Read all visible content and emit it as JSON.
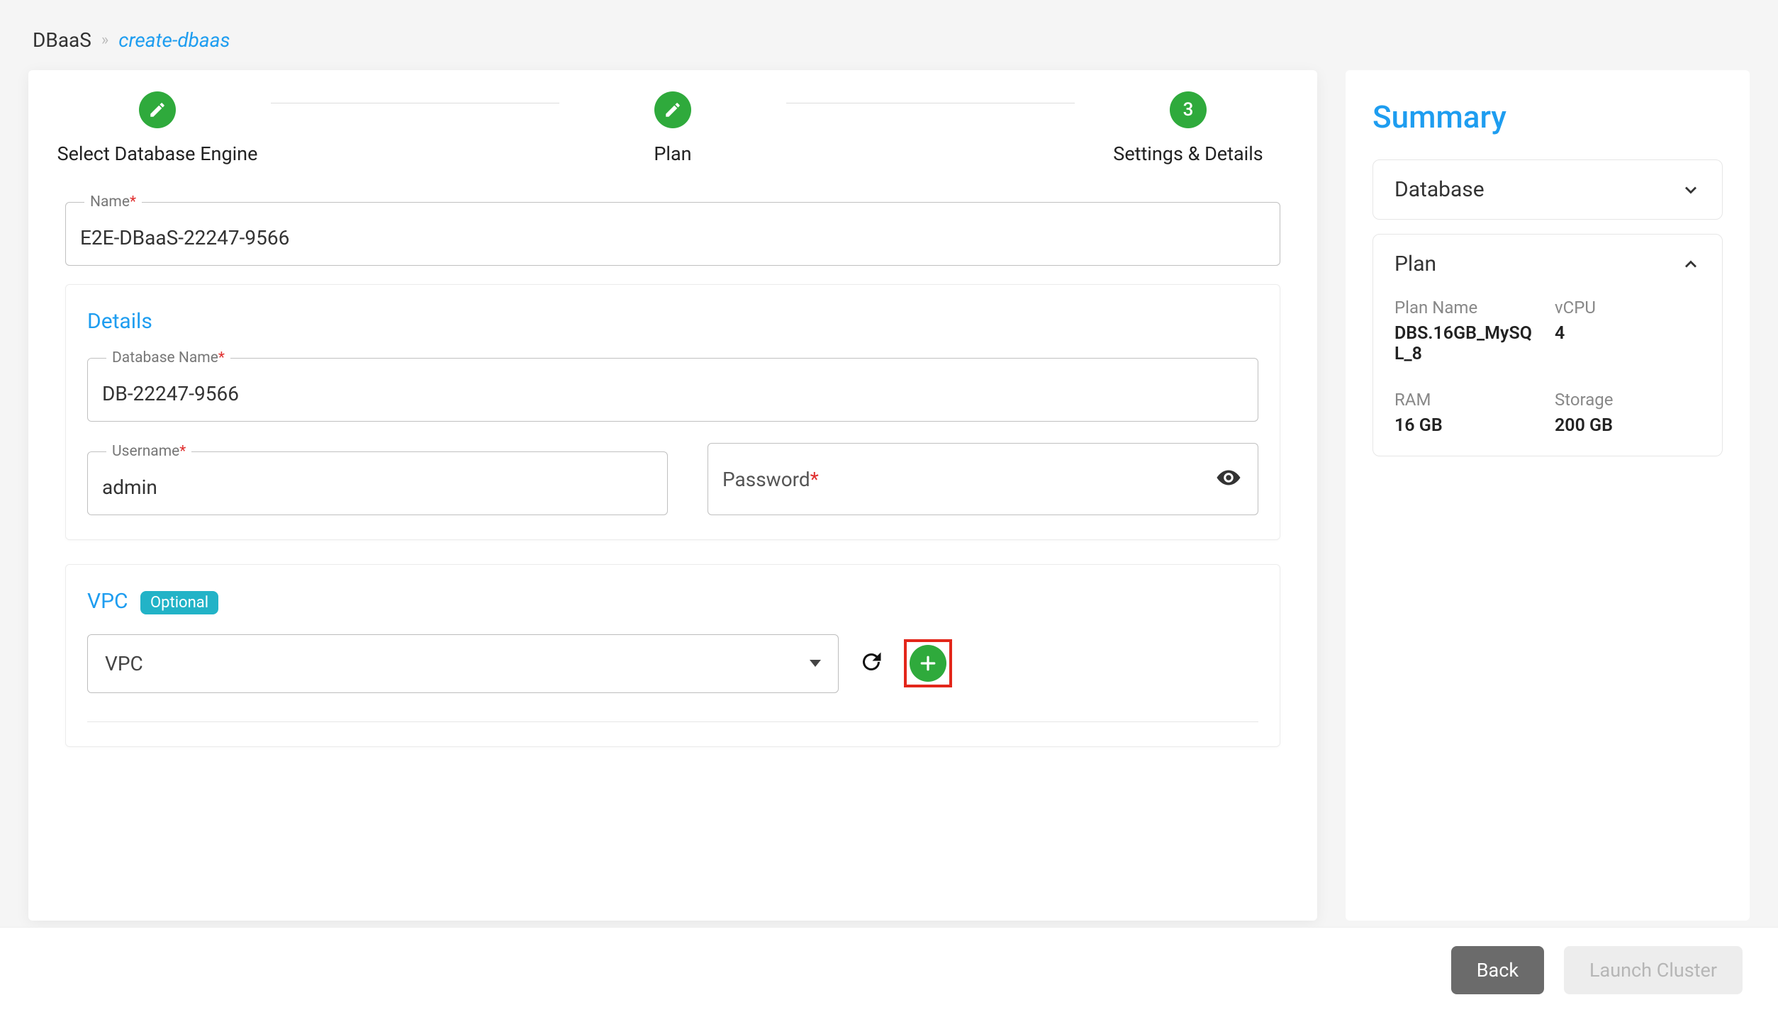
{
  "breadcrumb": {
    "root": "DBaaS",
    "sep": "»",
    "leaf": "create-dbaas"
  },
  "stepper": {
    "step1": {
      "label": "Select Database Engine"
    },
    "step2": {
      "label": "Plan"
    },
    "step3": {
      "label": "Settings & Details",
      "number": "3"
    }
  },
  "form": {
    "name_label": "Name",
    "name_value": "E2E-DBaaS-22247-9566",
    "details_heading": "Details",
    "db_name_label": "Database Name",
    "db_name_value": "DB-22247-9566",
    "username_label": "Username",
    "username_value": "admin",
    "password_label": "Password",
    "vpc_heading": "VPC",
    "vpc_badge": "Optional",
    "vpc_select_placeholder": "VPC"
  },
  "summary": {
    "title": "Summary",
    "database_section": "Database",
    "plan_section": "Plan",
    "plan_name_label": "Plan Name",
    "plan_name_value": "DBS.16GB_MySQL_8",
    "vcpu_label": "vCPU",
    "vcpu_value": "4",
    "ram_label": "RAM",
    "ram_value": "16 GB",
    "storage_label": "Storage",
    "storage_value": "200 GB"
  },
  "footer": {
    "back": "Back",
    "launch": "Launch Cluster"
  }
}
